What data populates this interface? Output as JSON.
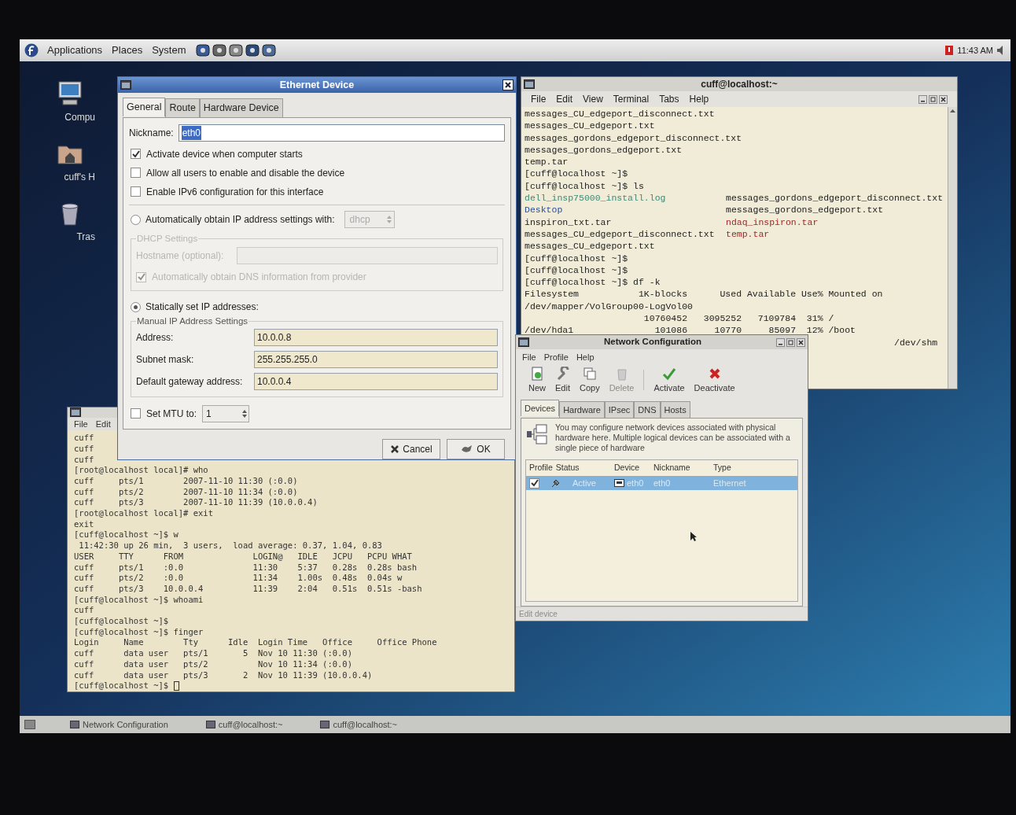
{
  "top_panel": {
    "menus": [
      "Applications",
      "Places",
      "System"
    ],
    "clock": "11:43 AM"
  },
  "desktop_icons": [
    {
      "kind": "computer",
      "label": "Compu"
    },
    {
      "kind": "home",
      "label": "cuff's H"
    },
    {
      "kind": "trash",
      "label": "Tras"
    }
  ],
  "ethernet_device": {
    "title": "Ethernet Device",
    "tabs": [
      {
        "label": "General",
        "selected": true
      },
      {
        "label": "Route",
        "selected": false
      },
      {
        "label": "Hardware Device",
        "selected": false
      }
    ],
    "nickname": {
      "label": "Nickname:",
      "value": "eth0"
    },
    "options": [
      {
        "label": "Activate device when computer starts",
        "checked": true
      },
      {
        "label": "Allow all users to enable and disable the device",
        "checked": false
      },
      {
        "label": "Enable IPv6 configuration for this interface",
        "checked": false
      }
    ],
    "auto_ip": {
      "label": "Automatically obtain IP address settings with:",
      "selected": false,
      "protocol": "dhcp"
    },
    "dhcp_settings": {
      "title": "DHCP Settings",
      "disabled": true,
      "hostname_label": "Hostname (optional):",
      "dns_label": "Automatically obtain DNS information from provider",
      "dns_checked": true
    },
    "static_ip": {
      "label": "Statically set IP addresses:",
      "selected": true
    },
    "manual": {
      "title": "Manual IP Address Settings",
      "fields": [
        {
          "label": "Address:",
          "value": "10.0.0.8"
        },
        {
          "label": "Subnet mask:",
          "value": "255.255.255.0"
        },
        {
          "label": "Default gateway address:",
          "value": "10.0.0.4"
        }
      ]
    },
    "mtu": {
      "label": "Set MTU to:",
      "checked": false,
      "value": "1"
    },
    "buttons": [
      {
        "kind": "cancel",
        "label": "Cancel"
      },
      {
        "kind": "ok",
        "label": "OK"
      }
    ]
  },
  "terminal_right": {
    "title": "cuff@localhost:~",
    "menus": [
      "File",
      "Edit",
      "View",
      "Terminal",
      "Tabs",
      "Help"
    ],
    "lines": [
      {
        "kind": "text",
        "text": "messages_CU_edgeport_disconnect.txt"
      },
      {
        "kind": "text",
        "text": "messages_CU_edgeport.txt"
      },
      {
        "kind": "text",
        "text": "messages_gordons_edgeport_disconnect.txt"
      },
      {
        "kind": "text",
        "text": "messages_gordons_edgeport.txt"
      },
      {
        "kind": "text",
        "text": "temp.tar"
      },
      {
        "kind": "text",
        "text": "[cuff@localhost ~]$"
      },
      {
        "kind": "text",
        "text": "[cuff@localhost ~]$ ls"
      },
      {
        "kind": "ls",
        "left": {
          "text": "dell_insp75000_install.log",
          "color": "#3c8c78"
        },
        "right": {
          "text": "messages_gordons_edgeport_disconnect.txt",
          "color": "#222222"
        }
      },
      {
        "kind": "ls",
        "left": {
          "text": "Desktop",
          "color": "#2850a0"
        },
        "right": {
          "text": "messages_gordons_edgeport.txt",
          "color": "#222222"
        }
      },
      {
        "kind": "ls",
        "left": {
          "text": "inspiron_txt.tar",
          "color": "#222222"
        },
        "right": {
          "text": "ndaq_inspiron.tar",
          "color": "#a02828"
        }
      },
      {
        "kind": "ls",
        "left": {
          "text": "messages_CU_edgeport_disconnect.txt",
          "color": "#222222"
        },
        "right": {
          "text": "temp.tar",
          "color": "#a02828"
        }
      },
      {
        "kind": "text",
        "text": "messages_CU_edgeport.txt"
      },
      {
        "kind": "text",
        "text": "[cuff@localhost ~]$"
      },
      {
        "kind": "text",
        "text": "[cuff@localhost ~]$"
      },
      {
        "kind": "text",
        "text": "[cuff@localhost ~]$ df -k"
      },
      {
        "kind": "text",
        "text": "Filesystem           1K-blocks      Used Available Use% Mounted on"
      },
      {
        "kind": "text",
        "text": "/dev/mapper/VolGroup00-LogVol00"
      },
      {
        "kind": "text",
        "text": "                      10760452   3095252   7109784  31% /"
      },
      {
        "kind": "text",
        "text": "/dev/hda1               101086     10770     85097  12% /boot"
      },
      {
        "kind": "mount",
        "text": "/dev/shm"
      }
    ]
  },
  "terminal_left": {
    "menus": [
      "File",
      "Edit"
    ],
    "lines": [
      "cuff",
      "cuff",
      "cuff",
      "[root@localhost local]# who",
      "cuff     pts/1        2007-11-10 11:30 (:0.0)",
      "cuff     pts/2        2007-11-10 11:34 (:0.0)",
      "cuff     pts/3        2007-11-10 11:39 (10.0.0.4)",
      "[root@localhost local]# exit",
      "exit",
      "[cuff@localhost ~]$ w",
      " 11:42:30 up 26 min,  3 users,  load average: 0.37, 1.04, 0.83",
      "USER     TTY      FROM              LOGIN@   IDLE   JCPU   PCPU WHAT",
      "cuff     pts/1    :0.0              11:30    5:37   0.28s  0.28s bash",
      "cuff     pts/2    :0.0              11:34    1.00s  0.48s  0.04s w",
      "cuff     pts/3    10.0.0.4          11:39    2:04   0.51s  0.51s -bash",
      "[cuff@localhost ~]$ whoami",
      "cuff",
      "[cuff@localhost ~]$",
      "[cuff@localhost ~]$ finger",
      "Login     Name        Tty      Idle  Login Time   Office     Office Phone",
      "cuff      data user   pts/1       5  Nov 10 11:30 (:0.0)",
      "cuff      data user   pts/2          Nov 10 11:34 (:0.0)",
      "cuff      data user   pts/3       2  Nov 10 11:39 (10.0.0.4)",
      "[cuff@localhost ~]$"
    ]
  },
  "network_configuration": {
    "title": "Network Configuration",
    "menus": [
      "File",
      "Profile",
      "Help"
    ],
    "toolbar": [
      {
        "kind": "new",
        "label": "New",
        "disabled": false
      },
      {
        "kind": "edit",
        "label": "Edit",
        "disabled": false
      },
      {
        "kind": "copy",
        "label": "Copy",
        "disabled": false
      },
      {
        "kind": "delete",
        "label": "Delete",
        "disabled": true
      },
      {
        "kind": "activate",
        "label": "Activate",
        "disabled": false
      },
      {
        "kind": "deactivate",
        "label": "Deactivate",
        "disabled": false
      }
    ],
    "tabs": [
      {
        "label": "Devices",
        "selected": true
      },
      {
        "label": "Hardware",
        "selected": false
      },
      {
        "label": "IPsec",
        "selected": false
      },
      {
        "label": "DNS",
        "selected": false
      },
      {
        "label": "Hosts",
        "selected": false
      }
    ],
    "description": "You may configure network devices associated with physical hardware here.  Multiple logical devices can be associated with a single piece of hardware",
    "columns": [
      "Profile",
      "Status",
      "Device",
      "Nickname",
      "Type"
    ],
    "rows": [
      {
        "profile_checked": true,
        "status": "Active",
        "device": "eth0",
        "nickname": "eth0",
        "type": "Ethernet",
        "selected": true
      }
    ],
    "status_bar": "Edit device"
  },
  "taskbar": [
    {
      "label": "Network Configuration"
    },
    {
      "label": "cuff@localhost:~"
    },
    {
      "label": "cuff@localhost:~"
    }
  ]
}
